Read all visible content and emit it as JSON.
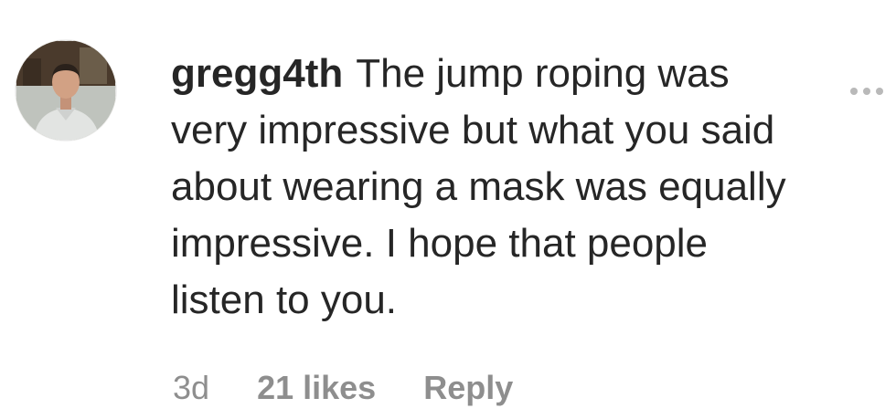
{
  "comment": {
    "username": "gregg4th",
    "text_lines": [
      "The jump roping was",
      "very impressive but what you said",
      "about wearing a mask was equally",
      "impressive. I hope that people",
      "listen to you."
    ],
    "more_icon": "ellipsis-icon",
    "avatar_icon": "user-avatar",
    "meta": {
      "timestamp": "3d",
      "likes": "21 likes",
      "reply_label": "Reply"
    }
  },
  "colors": {
    "text": "#262626",
    "meta": "#8e8e8e",
    "dots": "#b9b9b9"
  }
}
